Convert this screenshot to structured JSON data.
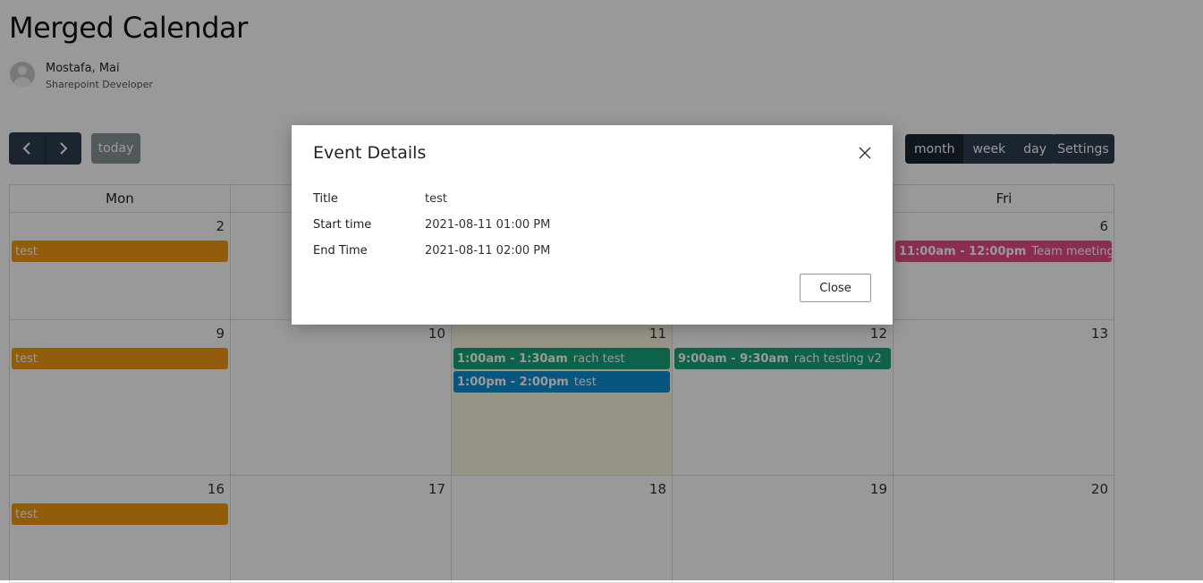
{
  "page": {
    "title": "Merged Calendar"
  },
  "user": {
    "name": "Mostafa, Mai",
    "role": "Sharepoint Developer"
  },
  "toolbar": {
    "prev_icon": "chevron-left-icon",
    "next_icon": "chevron-right-icon",
    "today_label": "today",
    "views": [
      {
        "label": "month",
        "active": true
      },
      {
        "label": "week",
        "active": false
      },
      {
        "label": "day",
        "active": false
      }
    ],
    "settings_label": "Settings"
  },
  "calendar": {
    "headers": [
      "Mon",
      "",
      "",
      "",
      "Fri"
    ],
    "weeks": [
      {
        "days": [
          {
            "num": "2",
            "events": [
              {
                "time": "",
                "title": "test",
                "color": "#f39c12"
              }
            ]
          },
          {
            "num": "",
            "events": []
          },
          {
            "num": "",
            "events": []
          },
          {
            "num": "",
            "events": []
          },
          {
            "num": "6",
            "events": [
              {
                "time": "11:00am - 12:00pm",
                "title": "Team meeting",
                "color": "#e74c87"
              }
            ]
          }
        ]
      },
      {
        "days": [
          {
            "num": "9",
            "events": [
              {
                "time": "",
                "title": "test",
                "color": "#f39c12"
              }
            ]
          },
          {
            "num": "10",
            "events": []
          },
          {
            "num": "11",
            "today": true,
            "events": [
              {
                "time": "1:00am - 1:30am",
                "title": "rach test",
                "color": "#17a37a"
              },
              {
                "time": "1:00pm - 2:00pm",
                "title": "test",
                "color": "#0b8fd6"
              }
            ]
          },
          {
            "num": "12",
            "events": [
              {
                "time": "9:00am - 9:30am",
                "title": "rach testing v2",
                "color": "#17a37a"
              }
            ]
          },
          {
            "num": "13",
            "events": []
          }
        ]
      },
      {
        "days": [
          {
            "num": "16",
            "events": [
              {
                "time": "",
                "title": "test",
                "color": "#f39c12"
              }
            ]
          },
          {
            "num": "17",
            "events": []
          },
          {
            "num": "18",
            "events": []
          },
          {
            "num": "19",
            "events": []
          },
          {
            "num": "20",
            "events": []
          }
        ]
      }
    ]
  },
  "modal": {
    "title": "Event Details",
    "close_icon": "close-icon",
    "fields": [
      {
        "label": "Title",
        "value": "test"
      },
      {
        "label": "Start time",
        "value": "2021-08-11 01:00 PM"
      },
      {
        "label": "End Time",
        "value": "2021-08-11 02:00 PM"
      }
    ],
    "close_label": "Close"
  }
}
